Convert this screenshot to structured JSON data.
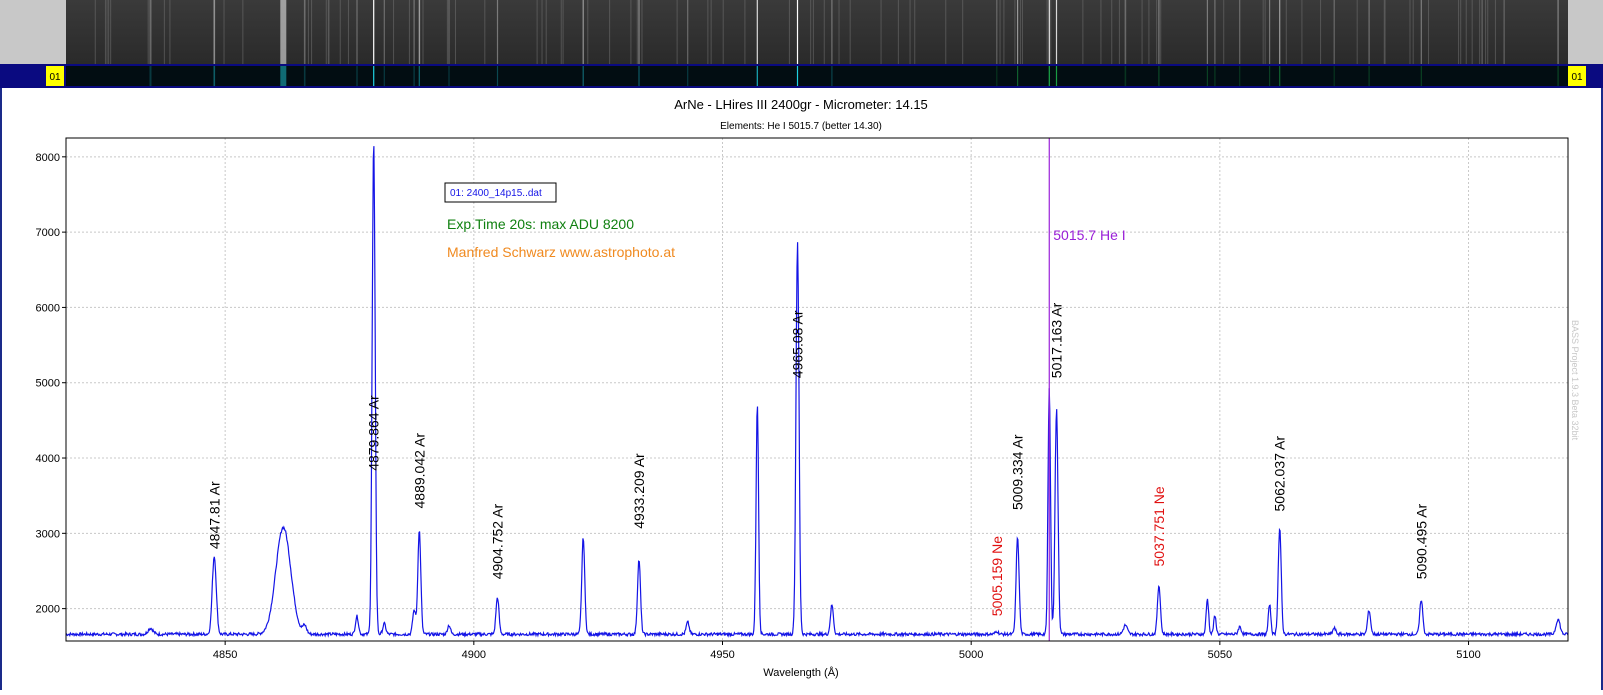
{
  "colors": {
    "spectrum": "#1414e6",
    "ar_label": "#000000",
    "ne_label": "#e01010",
    "he_marker": "#9a20d8",
    "exp_time": "#108010",
    "author": "#f08a20",
    "frame_header": "#0a0a80",
    "frame_marker": "#ffff00"
  },
  "header": {
    "frame_left_label": "01",
    "frame_right_label": "01"
  },
  "chart_data": {
    "type": "line",
    "title": "ArNe - LHires III 2400gr - Micrometer: 14.15",
    "subtitle": "Elements: He I 5015.7 (better 14.30)",
    "xlabel": "Wavelength (Å)",
    "ylabel": "",
    "xlim": [
      4818,
      5120
    ],
    "ylim": [
      1570,
      8250
    ],
    "x_ticks": [
      4850,
      4900,
      4950,
      5000,
      5050,
      5100
    ],
    "y_ticks": [
      2000,
      3000,
      4000,
      5000,
      6000,
      7000,
      8000
    ],
    "grid": true,
    "legend_position": "top-left",
    "series": [
      {
        "name": "01: 2400_14p15..dat"
      }
    ],
    "annotations": [
      {
        "text": "Exp.Time 20s: max ADU 8200",
        "color": "green"
      },
      {
        "text": "Manfred Schwarz www.astrophoto.at",
        "color": "orange"
      }
    ],
    "watermark": "BASS Project 1.9.3 Beta 32bit",
    "baseline": 1660,
    "peaks": [
      {
        "x": 4835.0,
        "y": 1740,
        "w": 0.5
      },
      {
        "x": 4847.81,
        "y": 2700,
        "w": 0.4
      },
      {
        "x": 4861.7,
        "y": 3080,
        "w": 1.5
      },
      {
        "x": 4866.0,
        "y": 1760,
        "w": 0.4
      },
      {
        "x": 4876.5,
        "y": 1900,
        "w": 0.3
      },
      {
        "x": 4879.864,
        "y": 8200,
        "w": 0.3
      },
      {
        "x": 4882.0,
        "y": 1800,
        "w": 0.3
      },
      {
        "x": 4888.0,
        "y": 1980,
        "w": 0.3
      },
      {
        "x": 4889.042,
        "y": 3040,
        "w": 0.3
      },
      {
        "x": 4895.0,
        "y": 1780,
        "w": 0.3
      },
      {
        "x": 4904.752,
        "y": 2150,
        "w": 0.3
      },
      {
        "x": 4922.0,
        "y": 2940,
        "w": 0.3
      },
      {
        "x": 4933.209,
        "y": 2650,
        "w": 0.3
      },
      {
        "x": 4943.0,
        "y": 1820,
        "w": 0.3
      },
      {
        "x": 4957.0,
        "y": 4720,
        "w": 0.25
      },
      {
        "x": 4965.08,
        "y": 6860,
        "w": 0.3
      },
      {
        "x": 4972.0,
        "y": 2050,
        "w": 0.3
      },
      {
        "x": 5005.159,
        "y": 1700,
        "w": 0.3
      },
      {
        "x": 5009.334,
        "y": 2950,
        "w": 0.3
      },
      {
        "x": 5015.7,
        "y": 4950,
        "w": 0.25
      },
      {
        "x": 5017.163,
        "y": 4650,
        "w": 0.3
      },
      {
        "x": 5031.0,
        "y": 1780,
        "w": 0.4
      },
      {
        "x": 5037.751,
        "y": 2310,
        "w": 0.3
      },
      {
        "x": 5047.5,
        "y": 2130,
        "w": 0.25
      },
      {
        "x": 5049.0,
        "y": 1900,
        "w": 0.25
      },
      {
        "x": 5054.0,
        "y": 1760,
        "w": 0.3
      },
      {
        "x": 5060.0,
        "y": 2060,
        "w": 0.25
      },
      {
        "x": 5062.037,
        "y": 3070,
        "w": 0.3
      },
      {
        "x": 5073.0,
        "y": 1740,
        "w": 0.3
      },
      {
        "x": 5080.0,
        "y": 1980,
        "w": 0.3
      },
      {
        "x": 5090.495,
        "y": 2120,
        "w": 0.3
      },
      {
        "x": 5118.0,
        "y": 1860,
        "w": 0.4
      }
    ],
    "line_labels": [
      {
        "x": 4847.81,
        "label": "4847.81 Ar",
        "y": 2790,
        "element": "Ar"
      },
      {
        "x": 4879.864,
        "label": "4879.864 Ar",
        "y": 3830,
        "element": "Ar"
      },
      {
        "x": 4889.042,
        "label": "4889.042 Ar",
        "y": 3330,
        "element": "Ar"
      },
      {
        "x": 4904.752,
        "label": "4904.752 Ar",
        "y": 2390,
        "element": "Ar"
      },
      {
        "x": 4933.209,
        "label": "4933.209 Ar",
        "y": 3060,
        "element": "Ar"
      },
      {
        "x": 4965.08,
        "label": "4965.08 Ar",
        "y": 5060,
        "element": "Ar"
      },
      {
        "x": 5005.159,
        "label": "5005.159 Ne",
        "y": 1900,
        "element": "Ne"
      },
      {
        "x": 5009.334,
        "label": "5009.334 Ar",
        "y": 3310,
        "element": "Ar"
      },
      {
        "x": 5017.163,
        "label": "5017.163 Ar",
        "y": 5060,
        "element": "Ar"
      },
      {
        "x": 5037.751,
        "label": "5037.751 Ne",
        "y": 2560,
        "element": "Ne"
      },
      {
        "x": 5062.037,
        "label": "5062.037 Ar",
        "y": 3290,
        "element": "Ar"
      },
      {
        "x": 5090.495,
        "label": "5090.495 Ar",
        "y": 2390,
        "element": "Ar"
      }
    ],
    "marker": {
      "x": 5015.7,
      "label": "5015.7 He I"
    }
  }
}
